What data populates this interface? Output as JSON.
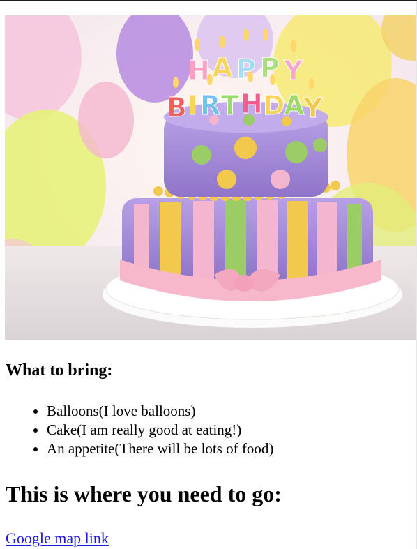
{
  "hero_image": {
    "alt_description_icon": "birthday-cake-image",
    "candle_letters_row1": [
      "H",
      "A",
      "P",
      "P",
      "Y"
    ],
    "candle_letters_row2": [
      "B",
      "I",
      "R",
      "T",
      "H",
      "D",
      "A",
      "Y"
    ],
    "colors": {
      "fondant_purple": "#a98fd6",
      "stripe_yellow": "#f2c94c",
      "stripe_green": "#9ccc65",
      "stripe_pink": "#f4b6cf",
      "bow_pink": "#f7b8cc"
    }
  },
  "bring": {
    "heading": "What to bring:",
    "items": [
      "Balloons(I love balloons)",
      "Cake(I am really good at eating!)",
      "An appetite(There will be lots of food)"
    ]
  },
  "directions": {
    "heading": "This is where you need to go:",
    "link_label": "Google map link"
  },
  "colors": {
    "link": "#1f1ae0",
    "text": "#000000",
    "background": "#ffffff"
  }
}
